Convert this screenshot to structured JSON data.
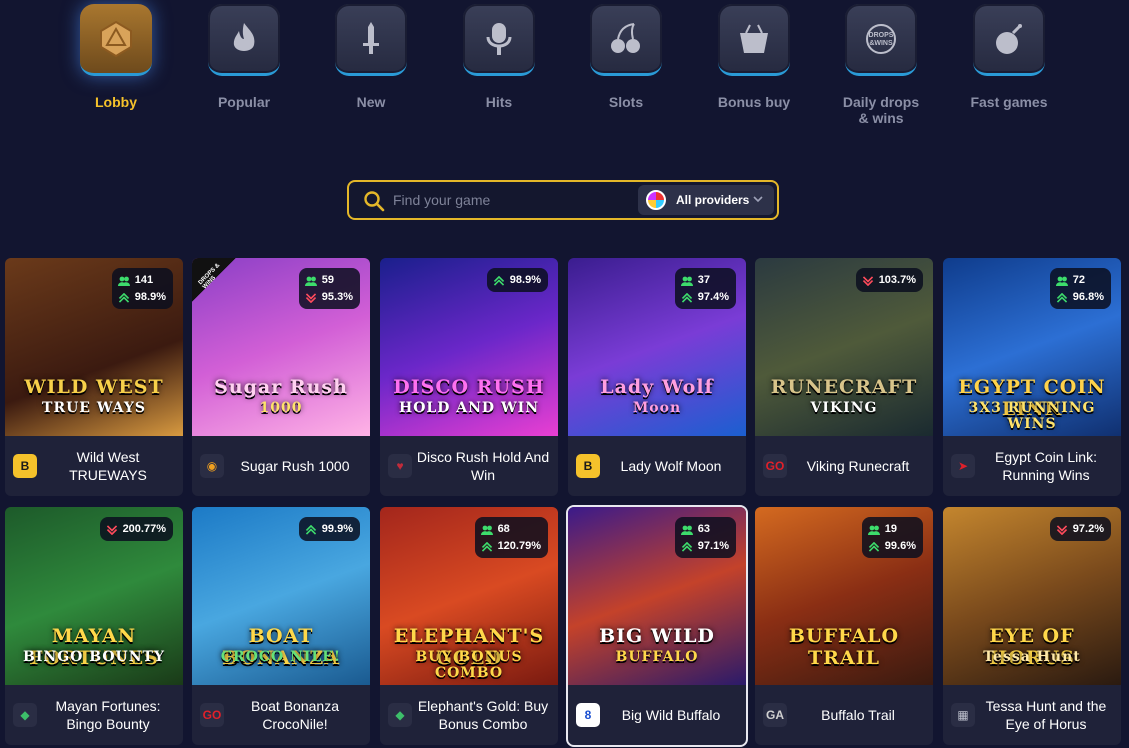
{
  "categories": [
    {
      "label": "Lobby",
      "icon": "dice-icon",
      "active": true
    },
    {
      "label": "Popular",
      "icon": "flame-icon"
    },
    {
      "label": "New",
      "icon": "sword-icon"
    },
    {
      "label": "Hits",
      "icon": "microphone-icon"
    },
    {
      "label": "Slots",
      "icon": "cherries-icon"
    },
    {
      "label": "Bonus buy",
      "icon": "basket-icon"
    },
    {
      "label": "Daily drops & wins",
      "icon": "drops-wins-icon"
    },
    {
      "label": "Fast games",
      "icon": "bomb-icon"
    }
  ],
  "search": {
    "placeholder": "Find your game",
    "providers_label": "All providers"
  },
  "colors": {
    "accent": "#f5c22b",
    "background": "#121530",
    "card": "#1f2239",
    "rtp_up": "#3ddc6c",
    "rtp_down": "#ff4b5c"
  },
  "games": [
    {
      "name": "Wild West TRUEWAYS",
      "art_title": "WILD WEST",
      "art_sub": "TRUE WAYS",
      "provider_icon": "bgaming-b-icon",
      "players": "141",
      "rtp": "98.9%",
      "rtp_trend": "up"
    },
    {
      "name": "Sugar Rush 1000",
      "art_title": "Sugar Rush",
      "art_sub": "1000",
      "provider_icon": "pragmatic-icon",
      "players": "59",
      "rtp": "95.3%",
      "rtp_trend": "down",
      "badge": "DROPS & WINS"
    },
    {
      "name": "Disco Rush Hold And Win",
      "art_title": "DISCO RUSH",
      "art_sub": "HOLD AND WIN",
      "provider_icon": "booongo-heart-icon",
      "rtp": "98.9%",
      "rtp_trend": "up"
    },
    {
      "name": "Lady Wolf Moon",
      "art_title": "Lady Wolf",
      "art_sub": "Moon",
      "provider_icon": "bgaming-b-icon",
      "players": "37",
      "rtp": "97.4%",
      "rtp_trend": "up"
    },
    {
      "name": "Viking Runecraft",
      "art_title": "RUNECRAFT",
      "art_sub": "VIKING",
      "provider_icon": "playngo-icon",
      "rtp": "103.7%",
      "rtp_trend": "down"
    },
    {
      "name": "Egypt Coin Link: Running Wins",
      "art_title": "EGYPT COIN LINK",
      "art_sub": "3X3 RUNNING WINS",
      "provider_icon": "evoplay-icon",
      "players": "72",
      "rtp": "96.8%",
      "rtp_trend": "up"
    },
    {
      "name": "Mayan Fortunes: Bingo Bounty",
      "art_title": "MAYAN FORTUNES",
      "art_sub": "BINGO BOUNTY",
      "provider_icon": "green-diamond-icon",
      "rtp": "200.77%",
      "rtp_trend": "down"
    },
    {
      "name": "Boat Bonanza CrocoNile!",
      "art_title": "BOAT BONANZA",
      "art_sub": "CROCO NILE!",
      "provider_icon": "playngo-icon",
      "rtp": "99.9%",
      "rtp_trend": "up"
    },
    {
      "name": "Elephant's Gold: Buy Bonus Combo",
      "art_title": "ELEPHANT'S GOLD",
      "art_sub": "BUY BONUS COMBO",
      "provider_icon": "green-diamond-icon",
      "players": "68",
      "rtp": "120.79%",
      "rtp_trend": "up"
    },
    {
      "name": "Big Wild Buffalo",
      "art_title": "BIG WILD",
      "art_sub": "BUFFALO",
      "provider_icon": "blue-square-icon",
      "players": "63",
      "rtp": "97.1%",
      "rtp_trend": "up",
      "selected": true
    },
    {
      "name": "Buffalo Trail",
      "art_title": "BUFFALO TRAIL",
      "art_sub": "",
      "provider_icon": "gameart-icon",
      "players": "19",
      "rtp": "99.6%",
      "rtp_trend": "up"
    },
    {
      "name": "Tessa Hunt and the Eye of Horus",
      "art_title": "EYE OF HORUS",
      "art_sub": "Tessa Hunt",
      "provider_icon": "maze-icon",
      "rtp": "97.2%",
      "rtp_trend": "down"
    }
  ]
}
